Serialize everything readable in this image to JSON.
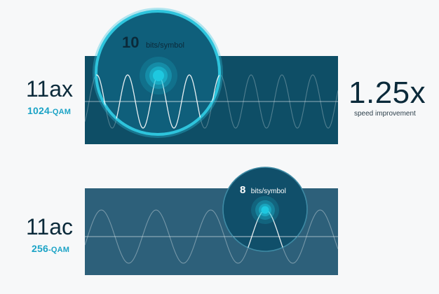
{
  "ax": {
    "name": "11ax",
    "modulation_num": "1024",
    "modulation_suffix": "-QAM",
    "bits_num": "10",
    "bits_unit": "bits/symbol"
  },
  "ac": {
    "name": "11ac",
    "modulation_num": "256",
    "modulation_suffix": "-QAM",
    "bits_num": "8",
    "bits_unit": "bits/symbol"
  },
  "improvement": {
    "value": "1.25x",
    "label": "speed improvement"
  },
  "colors": {
    "ax_panel": "#0e4e66",
    "ac_panel": "#2d607a",
    "accent": "#1ec8e0",
    "lens_ax": "#0f5f7b",
    "lens_ac": "#104f6a",
    "ax_ring": "#2ec4dc",
    "ac_ring": "#3e8aa4"
  }
}
